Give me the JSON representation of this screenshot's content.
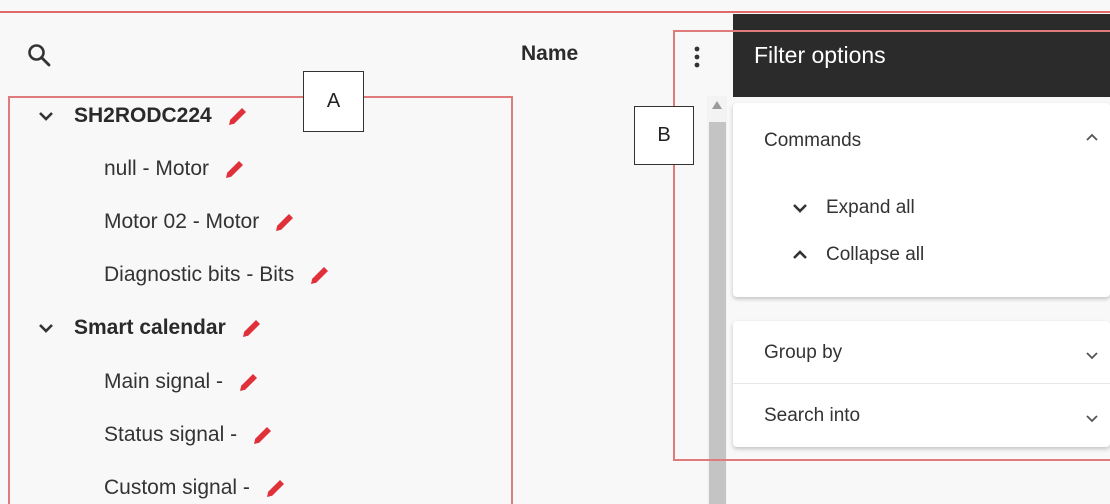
{
  "colors": {
    "accent_red": "#e0303a",
    "panel_header": "#2b2b2b",
    "annotation": "#e07b7b"
  },
  "header": {
    "name_column": "Name"
  },
  "tree": {
    "groups": [
      {
        "label": "SH2RODC224",
        "children": [
          "null - Motor",
          "Motor 02 - Motor",
          "Diagnostic bits - Bits"
        ]
      },
      {
        "label": "Smart calendar",
        "children": [
          "Main signal -",
          "Status signal -",
          "Custom signal -"
        ]
      }
    ]
  },
  "annotations": {
    "a": "A",
    "b": "B"
  },
  "filter_panel": {
    "title": "Filter options",
    "commands": {
      "title": "Commands",
      "expand_all": "Expand all",
      "collapse_all": "Collapse all"
    },
    "group_by": "Group by",
    "search_into": "Search into"
  }
}
